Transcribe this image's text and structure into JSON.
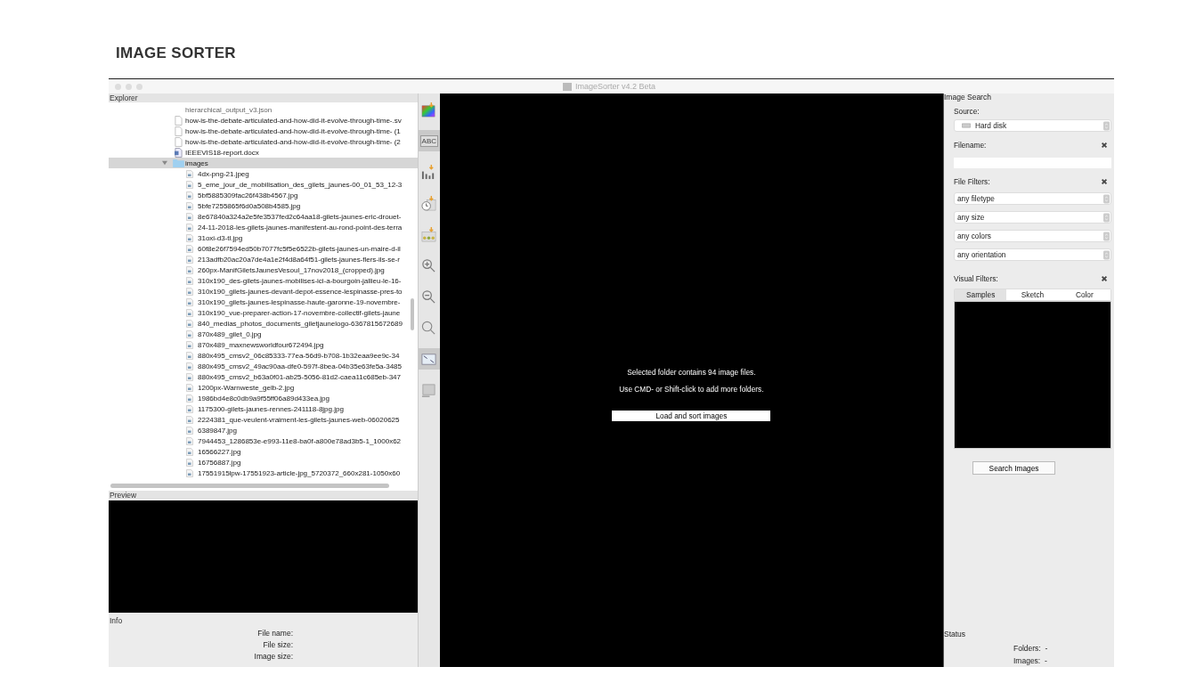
{
  "page_title": "IMAGE SORTER",
  "window": {
    "title": "ImageSorter v4.2 Beta"
  },
  "explorer": {
    "label": "Explorer",
    "items": [
      {
        "name": "hierarchical_output_v3.json",
        "kind": "plain",
        "selected": false
      },
      {
        "name": "how-is-the-debate-articulated-and-how-did-it-evolve-through-time-.sv",
        "kind": "file",
        "selected": false
      },
      {
        "name": "how-is-the-debate-articulated-and-how-did-it-evolve-through-time- (1",
        "kind": "file",
        "selected": false
      },
      {
        "name": "how-is-the-debate-articulated-and-how-did-it-evolve-through-time- (2",
        "kind": "file",
        "selected": false
      },
      {
        "name": "IEEEVIS18-report.docx",
        "kind": "document",
        "selected": false
      },
      {
        "name": "images",
        "kind": "folder",
        "selected": true,
        "expanded": true,
        "children": [
          {
            "name": "4dx-png-21.jpeg",
            "selected": false
          },
          {
            "name": "5_eme_jour_de_mobilisation_des_gilets_jaunes-00_01_53_12-3",
            "selected": false
          },
          {
            "name": "5bf5885309fac26f438b4567.jpg",
            "selected": false
          },
          {
            "name": "5bfe7255865f6d0a508b4585.jpg",
            "selected": false
          },
          {
            "name": "8e67840a324a2e5fe3537fed2c64aa18-gilets-jaunes-eric-drouet-",
            "selected": false
          },
          {
            "name": "24-11-2018-les-gilets-jaunes-manifestent-au-rond-point-des-terra",
            "selected": false
          },
          {
            "name": "31oxi-d3-tl.jpg",
            "selected": false
          },
          {
            "name": "60f8e26f7594ed50b7077fc5f5e6522b-gilets-jaunes-un-maire-d-il",
            "selected": false
          },
          {
            "name": "213adfb20ac20a7de4a1e2f4d8a64f51-gilets-jaunes-flers-ils-se-r",
            "selected": false
          },
          {
            "name": "260px-ManifGiletsJaunesVesoul_17nov2018_(cropped).jpg",
            "selected": false
          },
          {
            "name": "310x190_des-gilets-jaunes-mobilises-ici-a-bourgoin-jallieu-le-16-",
            "selected": false
          },
          {
            "name": "310x190_gilets-jaunes-devant-depot-essence-lespinasse-pres-to",
            "selected": false
          },
          {
            "name": "310x190_gilets-jaunes-lespinasse-haute-garonne-19-novembre-",
            "selected": false
          },
          {
            "name": "310x190_vue-preparer-action-17-novembre-collectif-gilets-jaune",
            "selected": false
          },
          {
            "name": "840_medias_photos_documents_giletjaunelogo-6367815672689",
            "selected": false
          },
          {
            "name": "870x489_gilet_0.jpg",
            "selected": false
          },
          {
            "name": "870x489_maxnewsworldfour672494.jpg",
            "selected": false
          },
          {
            "name": "880x495_cmsv2_06c85333-77ea-56d9-b708-1b32eaa9ee9c-34",
            "selected": false
          },
          {
            "name": "880x495_cmsv2_49ac90aa-dfe0-597f-8bea-04b35e63fe5a-3485",
            "selected": false
          },
          {
            "name": "880x495_cmsv2_b63a0f01-ab25-5056-81d2-caea11c685eb-347",
            "selected": false
          },
          {
            "name": "1200px-Warnweste_gelb-2.jpg",
            "selected": false
          },
          {
            "name": "1986bd4e8c0db9a9f55ff06a89d433ea.jpg",
            "selected": false
          },
          {
            "name": "1175300-gilets-jaunes-rennes-241118-8jpg.jpg",
            "selected": false
          },
          {
            "name": "2224381_que-veulent-vraiment-les-gilets-jaunes-web-06020625",
            "selected": false
          },
          {
            "name": "6389847.jpg",
            "selected": false
          },
          {
            "name": "7944453_1286853e-e993-11e8-ba0f-a800e78ad3b5-1_1000x62",
            "selected": false
          },
          {
            "name": "16566227.jpg",
            "selected": false
          },
          {
            "name": "16756887.jpg",
            "selected": false
          },
          {
            "name": "17551915lpw-17551923-article-jpg_5720372_660x281-1050x60",
            "selected": false
          }
        ]
      }
    ]
  },
  "preview": {
    "label": "Preview"
  },
  "info": {
    "label": "Info",
    "fields": [
      "File name:",
      "File size:",
      "Image size:"
    ]
  },
  "toolbar": [
    {
      "kind": "sort-color",
      "selected": false
    },
    {
      "kind": "sort-name",
      "label": "ABC",
      "selected": true
    },
    {
      "kind": "sort-bars",
      "selected": false
    },
    {
      "kind": "sort-clock",
      "selected": false
    },
    {
      "kind": "sort-dots",
      "selected": false
    },
    {
      "kind": "zoom-in",
      "selected": false
    },
    {
      "kind": "zoom-out",
      "selected": false
    },
    {
      "kind": "search",
      "selected": false
    },
    {
      "kind": "fit",
      "selected": true
    },
    {
      "kind": "frame",
      "selected": false
    }
  ],
  "canvas": {
    "messages": [
      "Selected folder contains 94 image files.",
      "Use CMD- or Shift-click to add more folders."
    ],
    "button": "Load and sort images"
  },
  "search": {
    "label": "Image Search",
    "source_label": "Source:",
    "source": "Hard disk",
    "filename_label": "Filename:",
    "file_filters_label": "File Filters:",
    "filters": [
      "any filetype",
      "any size",
      "any colors",
      "any orientation"
    ],
    "visual_filters_label": "Visual Filters:",
    "tabs": [
      {
        "label": "Samples",
        "selected": true
      },
      {
        "label": "Sketch",
        "selected": false
      },
      {
        "label": "Color",
        "selected": false
      }
    ],
    "button": "Search Images"
  },
  "status": {
    "label": "Status",
    "fields": [
      "Folders:  -",
      "Images:  -"
    ]
  }
}
